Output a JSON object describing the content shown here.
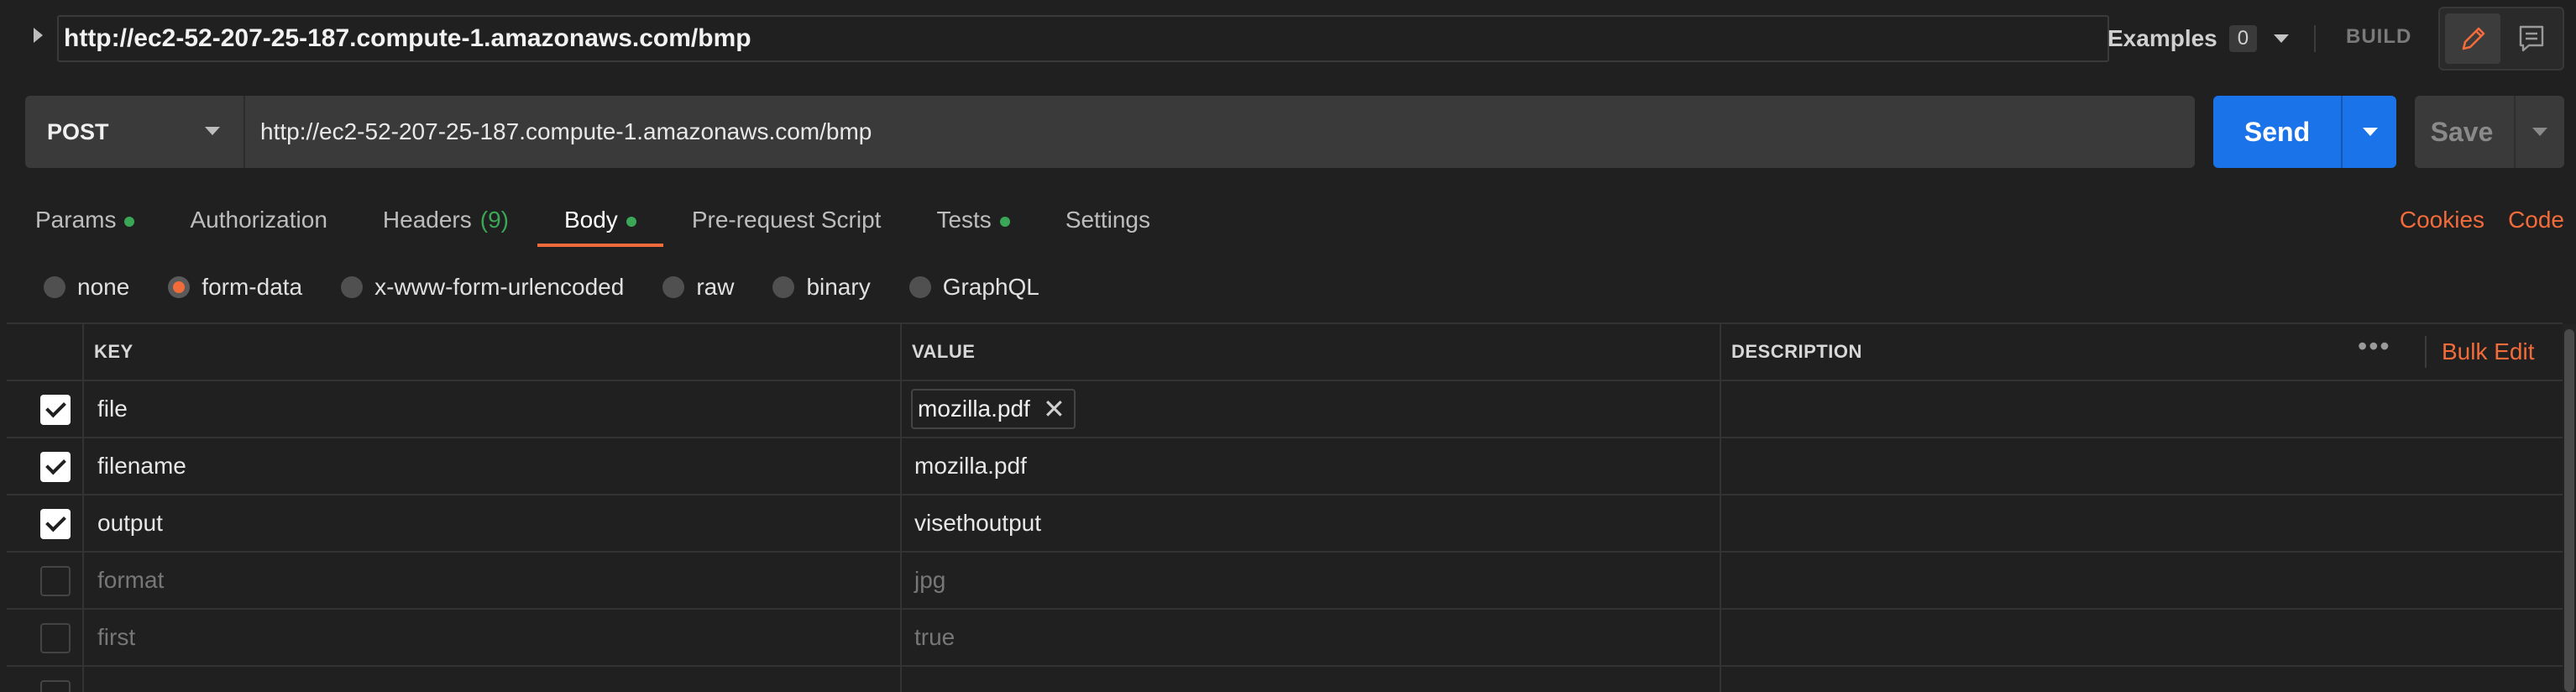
{
  "header": {
    "title": "http://ec2-52-207-25-187.compute-1.amazonaws.com/bmp",
    "examples_label": "Examples",
    "examples_count": "0",
    "build_label": "BUILD"
  },
  "request": {
    "method": "POST",
    "url": "http://ec2-52-207-25-187.compute-1.amazonaws.com/bmp",
    "send_label": "Send",
    "save_label": "Save"
  },
  "tabs": [
    {
      "label": "Params",
      "dot": true
    },
    {
      "label": "Authorization",
      "dot": false
    },
    {
      "label": "Headers",
      "count": "(9)"
    },
    {
      "label": "Body",
      "dot": true,
      "active": true
    },
    {
      "label": "Pre-request Script",
      "dot": false
    },
    {
      "label": "Tests",
      "dot": true
    },
    {
      "label": "Settings",
      "dot": false
    }
  ],
  "right_links": {
    "cookies": "Cookies",
    "code": "Code"
  },
  "body_types": [
    {
      "label": "none",
      "selected": false
    },
    {
      "label": "form-data",
      "selected": true
    },
    {
      "label": "x-www-form-urlencoded",
      "selected": false
    },
    {
      "label": "raw",
      "selected": false
    },
    {
      "label": "binary",
      "selected": false
    },
    {
      "label": "GraphQL",
      "selected": false
    }
  ],
  "table": {
    "headers": {
      "key": "KEY",
      "value": "VALUE",
      "description": "DESCRIPTION"
    },
    "more_label": "•••",
    "bulk_edit_label": "Bulk Edit",
    "rows": [
      {
        "key": "file",
        "value": "mozilla.pdf",
        "enabled": true,
        "is_file": true
      },
      {
        "key": "filename",
        "value": "mozilla.pdf",
        "enabled": true
      },
      {
        "key": "output",
        "value": "visethoutput",
        "enabled": true
      },
      {
        "key": "format",
        "value": "jpg",
        "enabled": false
      },
      {
        "key": "first",
        "value": "true",
        "enabled": false
      }
    ]
  },
  "colors": {
    "accent": "#f26b3a",
    "send_blue": "#1a73e8",
    "status_green": "#3aa757",
    "background": "#202020"
  },
  "icons": {
    "edit": "pencil-icon",
    "comment": "comment-icon",
    "remove_file": "close-icon"
  }
}
